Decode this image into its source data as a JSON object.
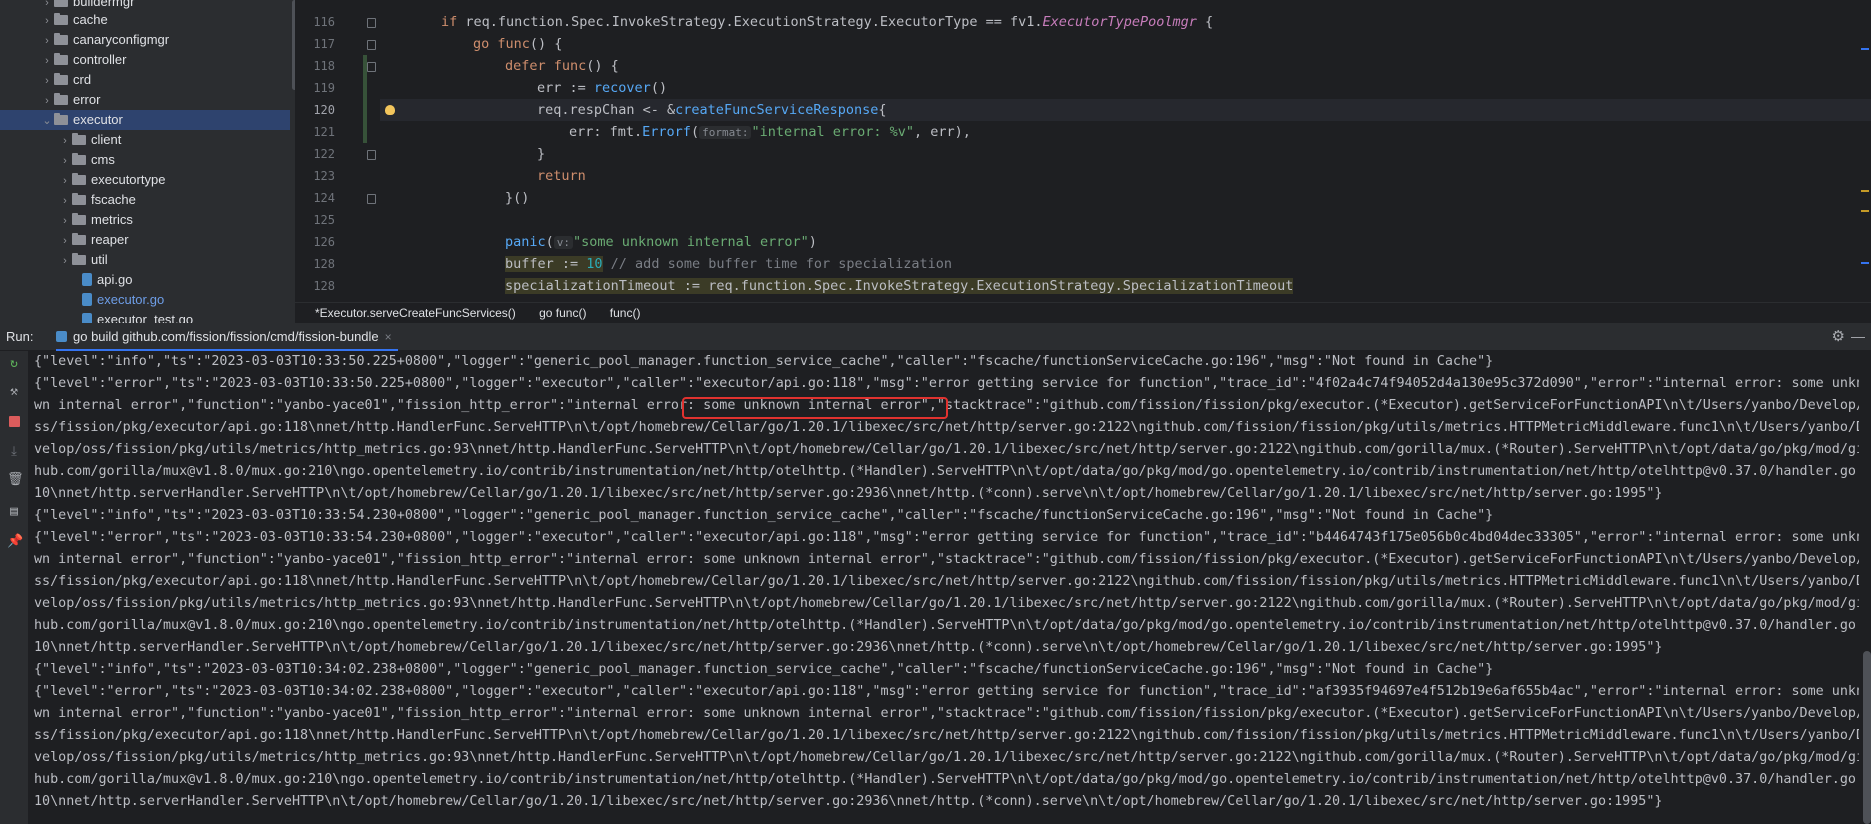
{
  "project_tree": {
    "items": [
      {
        "label": "buildermgr",
        "type": "folder",
        "expanded": false
      },
      {
        "label": "cache",
        "type": "folder",
        "expanded": false
      },
      {
        "label": "canaryconfigmgr",
        "type": "folder",
        "expanded": false
      },
      {
        "label": "controller",
        "type": "folder",
        "expanded": false
      },
      {
        "label": "crd",
        "type": "folder",
        "expanded": false
      },
      {
        "label": "error",
        "type": "folder",
        "expanded": false
      },
      {
        "label": "executor",
        "type": "folder",
        "expanded": true,
        "selected": true
      },
      {
        "label": "client",
        "type": "folder",
        "expanded": false
      },
      {
        "label": "cms",
        "type": "folder",
        "expanded": false
      },
      {
        "label": "executortype",
        "type": "folder",
        "expanded": false
      },
      {
        "label": "fscache",
        "type": "folder",
        "expanded": false
      },
      {
        "label": "metrics",
        "type": "folder",
        "expanded": false
      },
      {
        "label": "reaper",
        "type": "folder",
        "expanded": false
      },
      {
        "label": "util",
        "type": "folder",
        "expanded": false
      },
      {
        "label": "api.go",
        "type": "file"
      },
      {
        "label": "executor.go",
        "type": "file",
        "active": true
      },
      {
        "label": "executor_test.go",
        "type": "file"
      }
    ]
  },
  "editor": {
    "line_numbers": [
      "116",
      "117",
      "118",
      "119",
      "120",
      "121",
      "122",
      "123",
      "124",
      "125",
      "126",
      "127",
      "128"
    ],
    "current_line": "120",
    "lines": {
      "l116": {
        "kw_if": "if",
        "expr": "req.function.Spec.InvokeStrategy.ExecutionStrategy.ExecutorType == fv1.",
        "type": "ExecutorTypePoolmgr",
        "end": " {"
      },
      "l117": {
        "kw_go": "go",
        "kw_func": "func",
        "end": "() {"
      },
      "l118": {
        "kw_defer": "defer",
        "kw_func": "func",
        "end": "() {"
      },
      "l119": {
        "pre": "err := ",
        "fn": "recover",
        "end": "()"
      },
      "l120": {
        "pre": "req.respChan <- &",
        "fn": "createFuncServiceResponse",
        "end": "{"
      },
      "l121": {
        "pre": "err: fmt.",
        "fn": "Errorf",
        "open": "(",
        "hint": "format:",
        "str": "\"internal error: %v\"",
        "end": ", err),"
      },
      "l122": {
        "text": "}"
      },
      "l123": {
        "kw": "return"
      },
      "l124": {
        "text": "}()"
      },
      "l125": {
        "text": ""
      },
      "l126": {
        "fn": "panic",
        "open": "(",
        "hint": "v:",
        "str": "\"some unknown internal error\"",
        "end": ")"
      },
      "l127": {
        "pre": "buffer := ",
        "num": "10",
        "comment": " // add some buffer time for specialization"
      },
      "l128": {
        "text": "specializationTimeout := req.function.Spec.InvokeStrategy.ExecutionStrategy.SpecializationTimeout"
      }
    }
  },
  "breadcrumb": [
    "*Executor.serveCreateFuncServices()",
    "go func()",
    "func()"
  ],
  "run_panel": {
    "label": "Run:",
    "tab_title": "go build github.com/fission/fission/cmd/fission-bundle",
    "close": "×",
    "settings_icon": "gear-icon",
    "minimize": "—"
  },
  "console": {
    "lines": [
      "{\"level\":\"info\",\"ts\":\"2023-03-03T10:33:50.225+0800\",\"logger\":\"generic_pool_manager.function_service_cache\",\"caller\":\"fscache/functionServiceCache.go:196\",\"msg\":\"Not found in Cache\"}",
      "{\"level\":\"error\",\"ts\":\"2023-03-03T10:33:50.225+0800\",\"logger\":\"executor\",\"caller\":\"executor/api.go:118\",\"msg\":\"error getting service for function\",\"trace_id\":\"4f02a4c74f94052d4a130e95c372d090\",\"error\":\"internal error: some unkno",
      "wn internal error\",\"function\":\"yanbo-yace01\",\"fission_http_error\":\"internal error: some unknown internal error\",\"stacktrace\":\"github.com/fission/fission/pkg/executor.(*Executor).getServiceForFunctionAPI\\n\\t/Users/yanbo/Develop/o",
      "ss/fission/pkg/executor/api.go:118\\nnet/http.HandlerFunc.ServeHTTP\\n\\t/opt/homebrew/Cellar/go/1.20.1/libexec/src/net/http/server.go:2122\\ngithub.com/fission/fission/pkg/utils/metrics.HTTPMetricMiddleware.func1\\n\\t/Users/yanbo/De",
      "velop/oss/fission/pkg/utils/metrics/http_metrics.go:93\\nnet/http.HandlerFunc.ServeHTTP\\n\\t/opt/homebrew/Cellar/go/1.20.1/libexec/src/net/http/server.go:2122\\ngithub.com/gorilla/mux.(*Router).ServeHTTP\\n\\t/opt/data/go/pkg/mod/git",
      "hub.com/gorilla/mux@v1.8.0/mux.go:210\\ngo.opentelemetry.io/contrib/instrumentation/net/http/otelhttp.(*Handler).ServeHTTP\\n\\t/opt/data/go/pkg/mod/go.opentelemetry.io/contrib/instrumentation/net/http/otelhttp@v0.37.0/handler.go:2",
      "10\\nnet/http.serverHandler.ServeHTTP\\n\\t/opt/homebrew/Cellar/go/1.20.1/libexec/src/net/http/server.go:2936\\nnet/http.(*conn).serve\\n\\t/opt/homebrew/Cellar/go/1.20.1/libexec/src/net/http/server.go:1995\"}",
      "{\"level\":\"info\",\"ts\":\"2023-03-03T10:33:54.230+0800\",\"logger\":\"generic_pool_manager.function_service_cache\",\"caller\":\"fscache/functionServiceCache.go:196\",\"msg\":\"Not found in Cache\"}",
      "{\"level\":\"error\",\"ts\":\"2023-03-03T10:33:54.230+0800\",\"logger\":\"executor\",\"caller\":\"executor/api.go:118\",\"msg\":\"error getting service for function\",\"trace_id\":\"b4464743f175e056b0c4bd04dec33305\",\"error\":\"internal error: some unkno",
      "wn internal error\",\"function\":\"yanbo-yace01\",\"fission_http_error\":\"internal error: some unknown internal error\",\"stacktrace\":\"github.com/fission/fission/pkg/executor.(*Executor).getServiceForFunctionAPI\\n\\t/Users/yanbo/Develop/o",
      "ss/fission/pkg/executor/api.go:118\\nnet/http.HandlerFunc.ServeHTTP\\n\\t/opt/homebrew/Cellar/go/1.20.1/libexec/src/net/http/server.go:2122\\ngithub.com/fission/fission/pkg/utils/metrics.HTTPMetricMiddleware.func1\\n\\t/Users/yanbo/De",
      "velop/oss/fission/pkg/utils/metrics/http_metrics.go:93\\nnet/http.HandlerFunc.ServeHTTP\\n\\t/opt/homebrew/Cellar/go/1.20.1/libexec/src/net/http/server.go:2122\\ngithub.com/gorilla/mux.(*Router).ServeHTTP\\n\\t/opt/data/go/pkg/mod/git",
      "hub.com/gorilla/mux@v1.8.0/mux.go:210\\ngo.opentelemetry.io/contrib/instrumentation/net/http/otelhttp.(*Handler).ServeHTTP\\n\\t/opt/data/go/pkg/mod/go.opentelemetry.io/contrib/instrumentation/net/http/otelhttp@v0.37.0/handler.go:2",
      "10\\nnet/http.serverHandler.ServeHTTP\\n\\t/opt/homebrew/Cellar/go/1.20.1/libexec/src/net/http/server.go:2936\\nnet/http.(*conn).serve\\n\\t/opt/homebrew/Cellar/go/1.20.1/libexec/src/net/http/server.go:1995\"}",
      "{\"level\":\"info\",\"ts\":\"2023-03-03T10:34:02.238+0800\",\"logger\":\"generic_pool_manager.function_service_cache\",\"caller\":\"fscache/functionServiceCache.go:196\",\"msg\":\"Not found in Cache\"}",
      "{\"level\":\"error\",\"ts\":\"2023-03-03T10:34:02.238+0800\",\"logger\":\"executor\",\"caller\":\"executor/api.go:118\",\"msg\":\"error getting service for function\",\"trace_id\":\"af3935f94697e4f512b19e6af655b4ac\",\"error\":\"internal error: some unkno",
      "wn internal error\",\"function\":\"yanbo-yace01\",\"fission_http_error\":\"internal error: some unknown internal error\",\"stacktrace\":\"github.com/fission/fission/pkg/executor.(*Executor).getServiceForFunctionAPI\\n\\t/Users/yanbo/Develop/o",
      "ss/fission/pkg/executor/api.go:118\\nnet/http.HandlerFunc.ServeHTTP\\n\\t/opt/homebrew/Cellar/go/1.20.1/libexec/src/net/http/server.go:2122\\ngithub.com/fission/fission/pkg/utils/metrics.HTTPMetricMiddleware.func1\\n\\t/Users/yanbo/De",
      "velop/oss/fission/pkg/utils/metrics/http_metrics.go:93\\nnet/http.HandlerFunc.ServeHTTP\\n\\t/opt/homebrew/Cellar/go/1.20.1/libexec/src/net/http/server.go:2122\\ngithub.com/gorilla/mux.(*Router).ServeHTTP\\n\\t/opt/data/go/pkg/mod/git",
      "hub.com/gorilla/mux@v1.8.0/mux.go:210\\ngo.opentelemetry.io/contrib/instrumentation/net/http/otelhttp.(*Handler).ServeHTTP\\n\\t/opt/data/go/pkg/mod/go.opentelemetry.io/contrib/instrumentation/net/http/otelhttp@v0.37.0/handler.go:2",
      "10\\nnet/http.serverHandler.ServeHTTP\\n\\t/opt/homebrew/Cellar/go/1.20.1/libexec/src/net/http/server.go:2936\\nnet/http.(*conn).serve\\n\\t/opt/homebrew/Cellar/go/1.20.1/libexec/src/net/http/server.go:1995\"}"
    ]
  },
  "toolbar_icons": [
    "rerun-icon",
    "wrench-icon",
    "stop-icon",
    "scroll-to-end-icon",
    "trash-icon",
    "layout-icon",
    "pin-icon"
  ],
  "colors": {
    "accent": "#3574f0",
    "highlight_box": "#e0322f",
    "selection": "#2e436e",
    "keyword": "#cf8e6d",
    "function": "#56a8f5",
    "string": "#6aab73"
  }
}
